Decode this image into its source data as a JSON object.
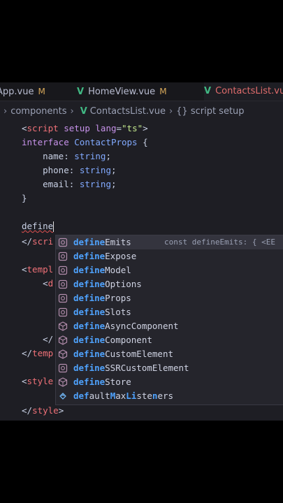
{
  "tabs": [
    {
      "label": "App.vue",
      "modified": "M"
    },
    {
      "label": "HomeView.vue",
      "modified": "M"
    },
    {
      "label": "ContactsList.vue"
    }
  ],
  "breadcrumb": {
    "items": [
      "components",
      "ContactsList.vue",
      "script setup"
    ],
    "braces": "{}"
  },
  "code": {
    "line1": {
      "lt": "<",
      "tag": "script",
      "attr1": "setup",
      "attr2": "lang",
      "eq": "=",
      "val": "\"ts\"",
      "gt": ">"
    },
    "line2": {
      "kw": "interface",
      "name": "ContactProps",
      "brace": "{"
    },
    "fields": [
      {
        "name": "name",
        "colon": ":",
        "type": "string",
        "semi": ";"
      },
      {
        "name": "phone",
        "colon": ":",
        "type": "string",
        "semi": ";"
      },
      {
        "name": "email",
        "colon": ":",
        "type": "string",
        "semi": ";"
      }
    ],
    "close_brace": "}",
    "typed": "define",
    "partial_lines": [
      {
        "lt": "</",
        "tag": "scri"
      },
      {
        "lt": "<",
        "tag": "templ"
      },
      {
        "lt": "<",
        "tag": "d"
      },
      {
        "lt": "</",
        "tag": ""
      },
      {
        "lt": "</",
        "tag": "temp"
      },
      {
        "lt": "<",
        "tag": "style"
      }
    ],
    "last_line": {
      "lt": "</",
      "tag": "style",
      "gt": ">"
    }
  },
  "suggestions": [
    {
      "match": "define",
      "rest": "Emits",
      "icon": "cube-outline-icon",
      "selected": true,
      "detail": "const defineEmits: { <EE"
    },
    {
      "match": "define",
      "rest": "Expose",
      "icon": "cube-outline-icon"
    },
    {
      "match": "define",
      "rest": "Model",
      "icon": "cube-outline-icon"
    },
    {
      "match": "define",
      "rest": "Options",
      "icon": "cube-outline-icon"
    },
    {
      "match": "define",
      "rest": "Props",
      "icon": "cube-outline-icon"
    },
    {
      "match": "define",
      "rest": "Slots",
      "icon": "cube-outline-icon"
    },
    {
      "match": "define",
      "rest": "AsyncComponent",
      "icon": "cube-filled-icon"
    },
    {
      "match": "define",
      "rest": "Component",
      "icon": "cube-filled-icon"
    },
    {
      "match": "define",
      "rest": "CustomElement",
      "icon": "cube-filled-icon"
    },
    {
      "match": "define",
      "rest": "SSRCustomElement",
      "icon": "cube-outline-icon"
    },
    {
      "match": "define",
      "rest": "Store",
      "icon": "cube-filled-icon"
    },
    {
      "match": "",
      "rest": "",
      "icon": "variable-icon",
      "segments": [
        "def",
        "ault",
        "M",
        "ax",
        "Li",
        "ste",
        "n",
        "ers"
      ]
    }
  ]
}
